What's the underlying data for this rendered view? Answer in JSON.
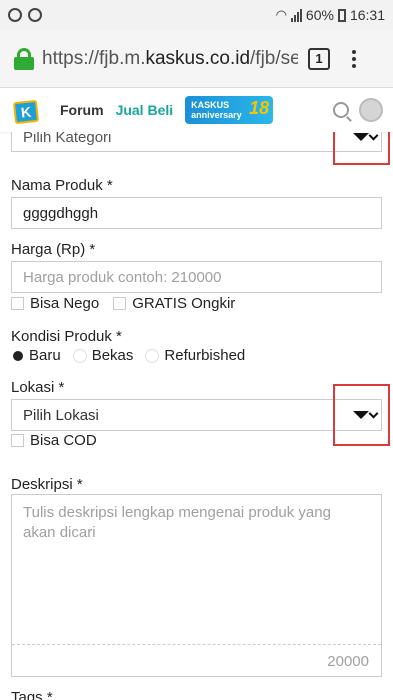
{
  "status_bar": {
    "battery": "60%",
    "time": "16:31"
  },
  "browser": {
    "url_prefix": "https://fjb.m.",
    "url_domain": "kaskus.co.id",
    "url_suffix": "/fjb/sel",
    "tab_count": "1"
  },
  "site_header": {
    "logo_letter": "K",
    "forum": "Forum",
    "jual_beli": "Jual Beli",
    "anniversary_text": "KASKUS anniversary",
    "anniversary_number": "18"
  },
  "form": {
    "kategori": {
      "value": "Pilih Kategori"
    },
    "nama_produk": {
      "label": "Nama Produk *",
      "value": "ggggdhggh"
    },
    "harga": {
      "label": "Harga (Rp) *",
      "placeholder": "Harga produk contoh: 210000"
    },
    "bisa_nego": "Bisa Nego",
    "gratis_ongkir": "GRATIS Ongkir",
    "kondisi": {
      "label": "Kondisi Produk *",
      "options": [
        "Baru",
        "Bekas",
        "Refurbished"
      ],
      "selected": "Baru"
    },
    "lokasi": {
      "label": "Lokasi *",
      "value": "Pilih Lokasi"
    },
    "bisa_cod": "Bisa COD",
    "deskripsi": {
      "label": "Deskripsi *",
      "placeholder": "Tulis deskripsi lengkap mengenai produk yang akan dicari",
      "counter": "20000"
    },
    "tags": {
      "label": "Tags *"
    }
  },
  "colors": {
    "accent_green": "#18a89a",
    "lock_green": "#2eaa33",
    "highlight_red": "#d93a3a"
  }
}
